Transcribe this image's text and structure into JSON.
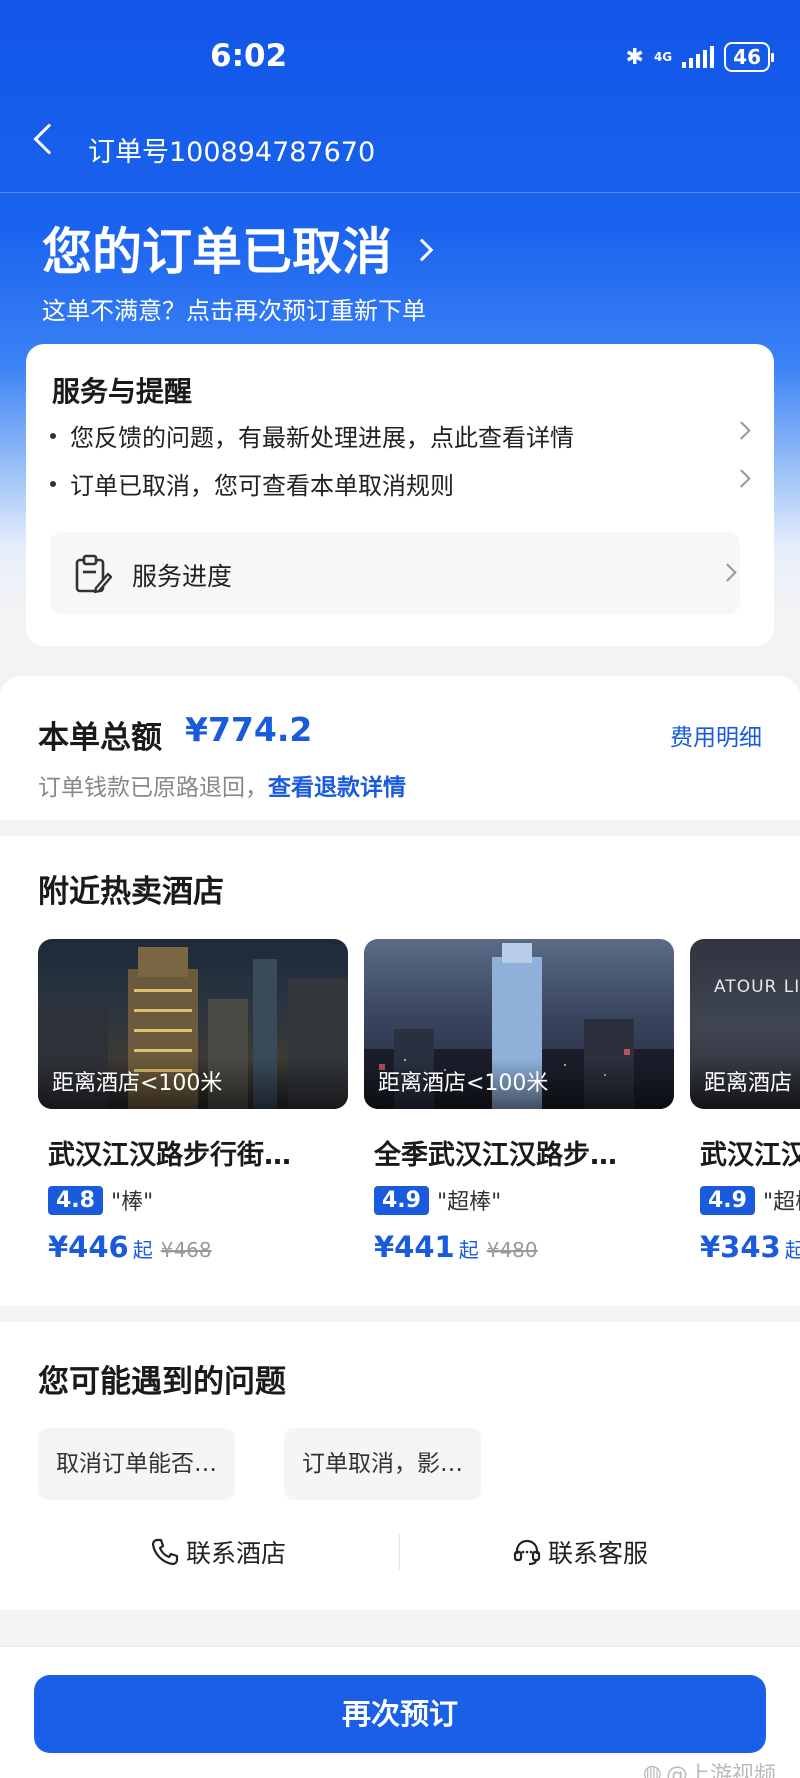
{
  "status_bar": {
    "time": "6:02",
    "network": "4G",
    "battery": "46"
  },
  "header": {
    "order_number": "订单号100894787670"
  },
  "hero": {
    "title": "您的订单已取消",
    "subtitle": "这单不满意？点击再次预订重新下单"
  },
  "service": {
    "title": "服务与提醒",
    "items": [
      "您反馈的问题，有最新处理进展，点此查看详情",
      "订单已取消，您可查看本单取消规则"
    ],
    "progress_label": "服务进度"
  },
  "payment": {
    "total_label": "本单总额",
    "total_amount": "¥774.2",
    "fee_detail": "费用明细",
    "refund_note": "订单钱款已原路退回，",
    "refund_link": "查看退款详情"
  },
  "nearby": {
    "title": "附近热卖酒店",
    "hotels": [
      {
        "distance": "距离酒店<100米",
        "name": "武汉江汉路步行街…",
        "score": "4.8",
        "rating_text": "\"棒\"",
        "price": "¥446",
        "price_suffix": "起",
        "original_price": "¥468"
      },
      {
        "distance": "距离酒店<100米",
        "name": "全季武汉江汉路步…",
        "score": "4.9",
        "rating_text": "\"超棒\"",
        "price": "¥441",
        "price_suffix": "起",
        "original_price": "¥480"
      },
      {
        "distance": "距离酒店",
        "name": "武汉江汉",
        "score": "4.9",
        "rating_text": "\"超棒\"",
        "price": "¥343",
        "price_suffix": "起",
        "image_text": "ATOUR LIGHT"
      }
    ]
  },
  "questions": {
    "title": "您可能遇到的问题",
    "chips": [
      "取消订单能否…",
      "订单取消，影…"
    ],
    "contact_hotel": "联系酒店",
    "contact_service": "联系客服"
  },
  "bottom": {
    "rebook_button": "再次预订",
    "watermark": "@上游视频"
  },
  "colors": {
    "primary": "#1a5bde",
    "hero_top": "#1256e8"
  }
}
